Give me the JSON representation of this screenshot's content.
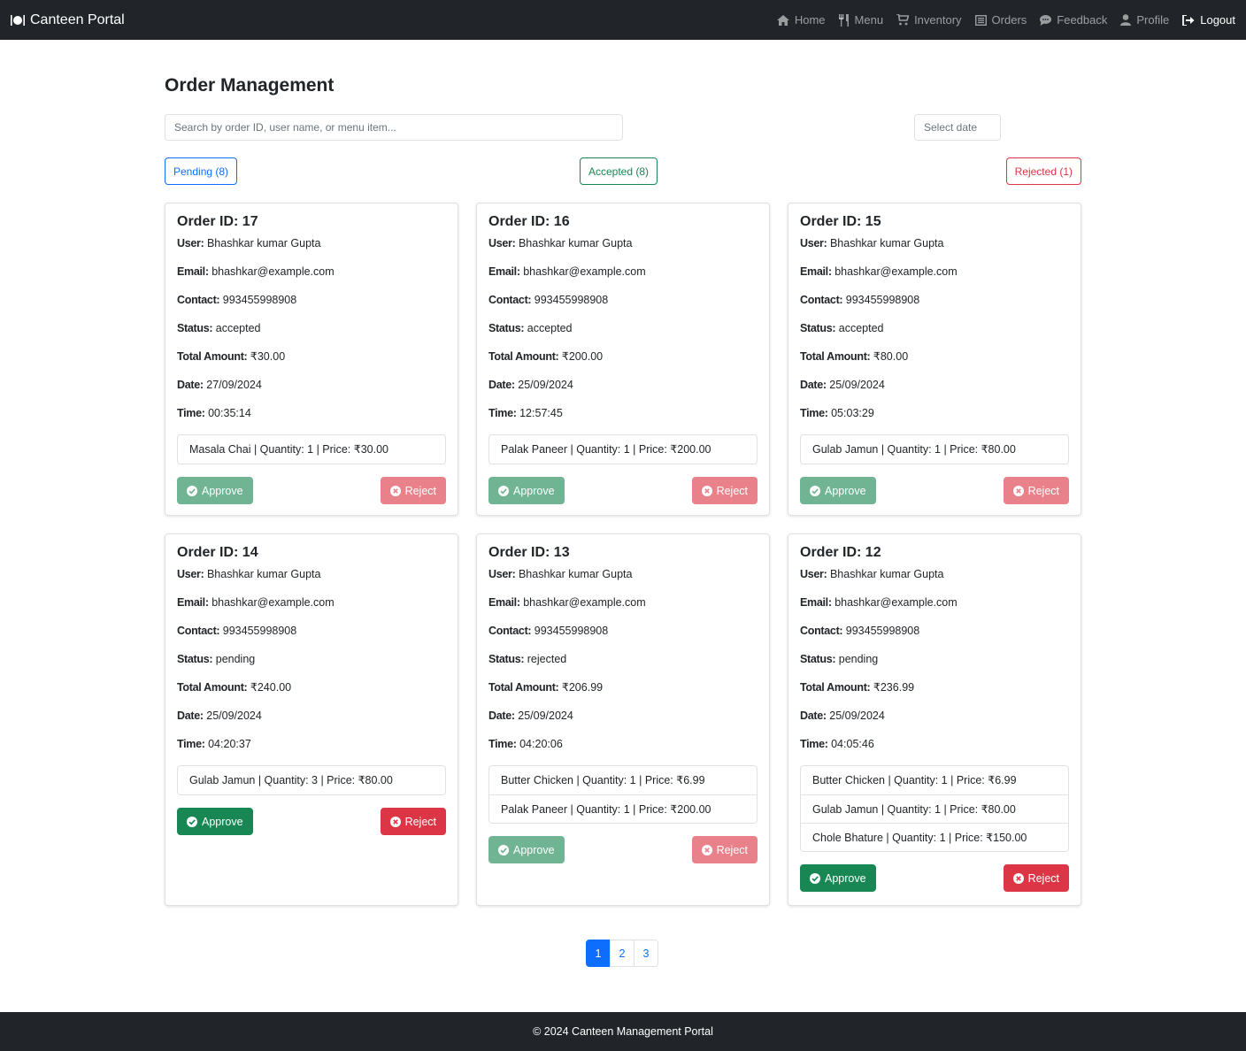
{
  "brand": {
    "name": "Canteen Portal",
    "icon": "dinner-plate-icon"
  },
  "nav": [
    {
      "label": "Home",
      "icon": "home-icon",
      "active": false
    },
    {
      "label": "Menu",
      "icon": "utensils-icon",
      "active": false
    },
    {
      "label": "Inventory",
      "icon": "cart-icon",
      "active": false
    },
    {
      "label": "Orders",
      "icon": "list-icon",
      "active": false
    },
    {
      "label": "Feedback",
      "icon": "chat-icon",
      "active": false
    },
    {
      "label": "Profile",
      "icon": "user-icon",
      "active": false
    },
    {
      "label": "Logout",
      "icon": "logout-icon",
      "active": true
    }
  ],
  "page": {
    "title": "Order Management"
  },
  "filters": {
    "search_placeholder": "Search by order ID, user name, or menu item...",
    "date_placeholder": "Select date"
  },
  "status_filters": {
    "pending": "Pending (8)",
    "accepted": "Accepted (8)",
    "rejected": "Rejected (1)"
  },
  "labels": {
    "user": "User:",
    "email": "Email:",
    "contact": "Contact:",
    "status": "Status:",
    "total": "Total Amount:",
    "date": "Date:",
    "time": "Time:",
    "approve": "Approve",
    "reject": "Reject"
  },
  "orders": [
    {
      "title": "Order ID: 17",
      "user": "Bhashkar kumar Gupta",
      "email": "bhashkar@example.com",
      "contact": "993455998908",
      "status": "accepted",
      "total": "₹30.00",
      "date": "27/09/2024",
      "time": "00:35:14",
      "items": [
        "Masala Chai | Quantity: 1 | Price: ₹30.00"
      ]
    },
    {
      "title": "Order ID: 16",
      "user": "Bhashkar kumar Gupta",
      "email": "bhashkar@example.com",
      "contact": "993455998908",
      "status": "accepted",
      "total": "₹200.00",
      "date": "25/09/2024",
      "time": "12:57:45",
      "items": [
        "Palak Paneer | Quantity: 1 | Price: ₹200.00"
      ]
    },
    {
      "title": "Order ID: 15",
      "user": "Bhashkar kumar Gupta",
      "email": "bhashkar@example.com",
      "contact": "993455998908",
      "status": "accepted",
      "total": "₹80.00",
      "date": "25/09/2024",
      "time": "05:03:29",
      "items": [
        "Gulab Jamun | Quantity: 1 | Price: ₹80.00"
      ]
    },
    {
      "title": "Order ID: 14",
      "user": "Bhashkar kumar Gupta",
      "email": "bhashkar@example.com",
      "contact": "993455998908",
      "status": "pending",
      "total": "₹240.00",
      "date": "25/09/2024",
      "time": "04:20:37",
      "items": [
        "Gulab Jamun | Quantity: 3 | Price: ₹80.00"
      ]
    },
    {
      "title": "Order ID: 13",
      "user": "Bhashkar kumar Gupta",
      "email": "bhashkar@example.com",
      "contact": "993455998908",
      "status": "rejected",
      "total": "₹206.99",
      "date": "25/09/2024",
      "time": "04:20:06",
      "items": [
        "Butter Chicken | Quantity: 1 | Price: ₹6.99",
        "Palak Paneer | Quantity: 1 | Price: ₹200.00"
      ]
    },
    {
      "title": "Order ID: 12",
      "user": "Bhashkar kumar Gupta",
      "email": "bhashkar@example.com",
      "contact": "993455998908",
      "status": "pending",
      "total": "₹236.99",
      "date": "25/09/2024",
      "time": "04:05:46",
      "items": [
        "Butter Chicken | Quantity: 1 | Price: ₹6.99",
        "Gulab Jamun | Quantity: 1 | Price: ₹80.00",
        "Chole Bhature | Quantity: 1 | Price: ₹150.00"
      ]
    }
  ],
  "pagination": {
    "pages": [
      "1",
      "2",
      "3"
    ],
    "current": "1"
  },
  "footer": {
    "text": "© 2024 Canteen Management Portal"
  },
  "colors": {
    "navbar": "#212529",
    "primary": "#0d6efd",
    "success": "#198754",
    "danger": "#dc3545"
  }
}
